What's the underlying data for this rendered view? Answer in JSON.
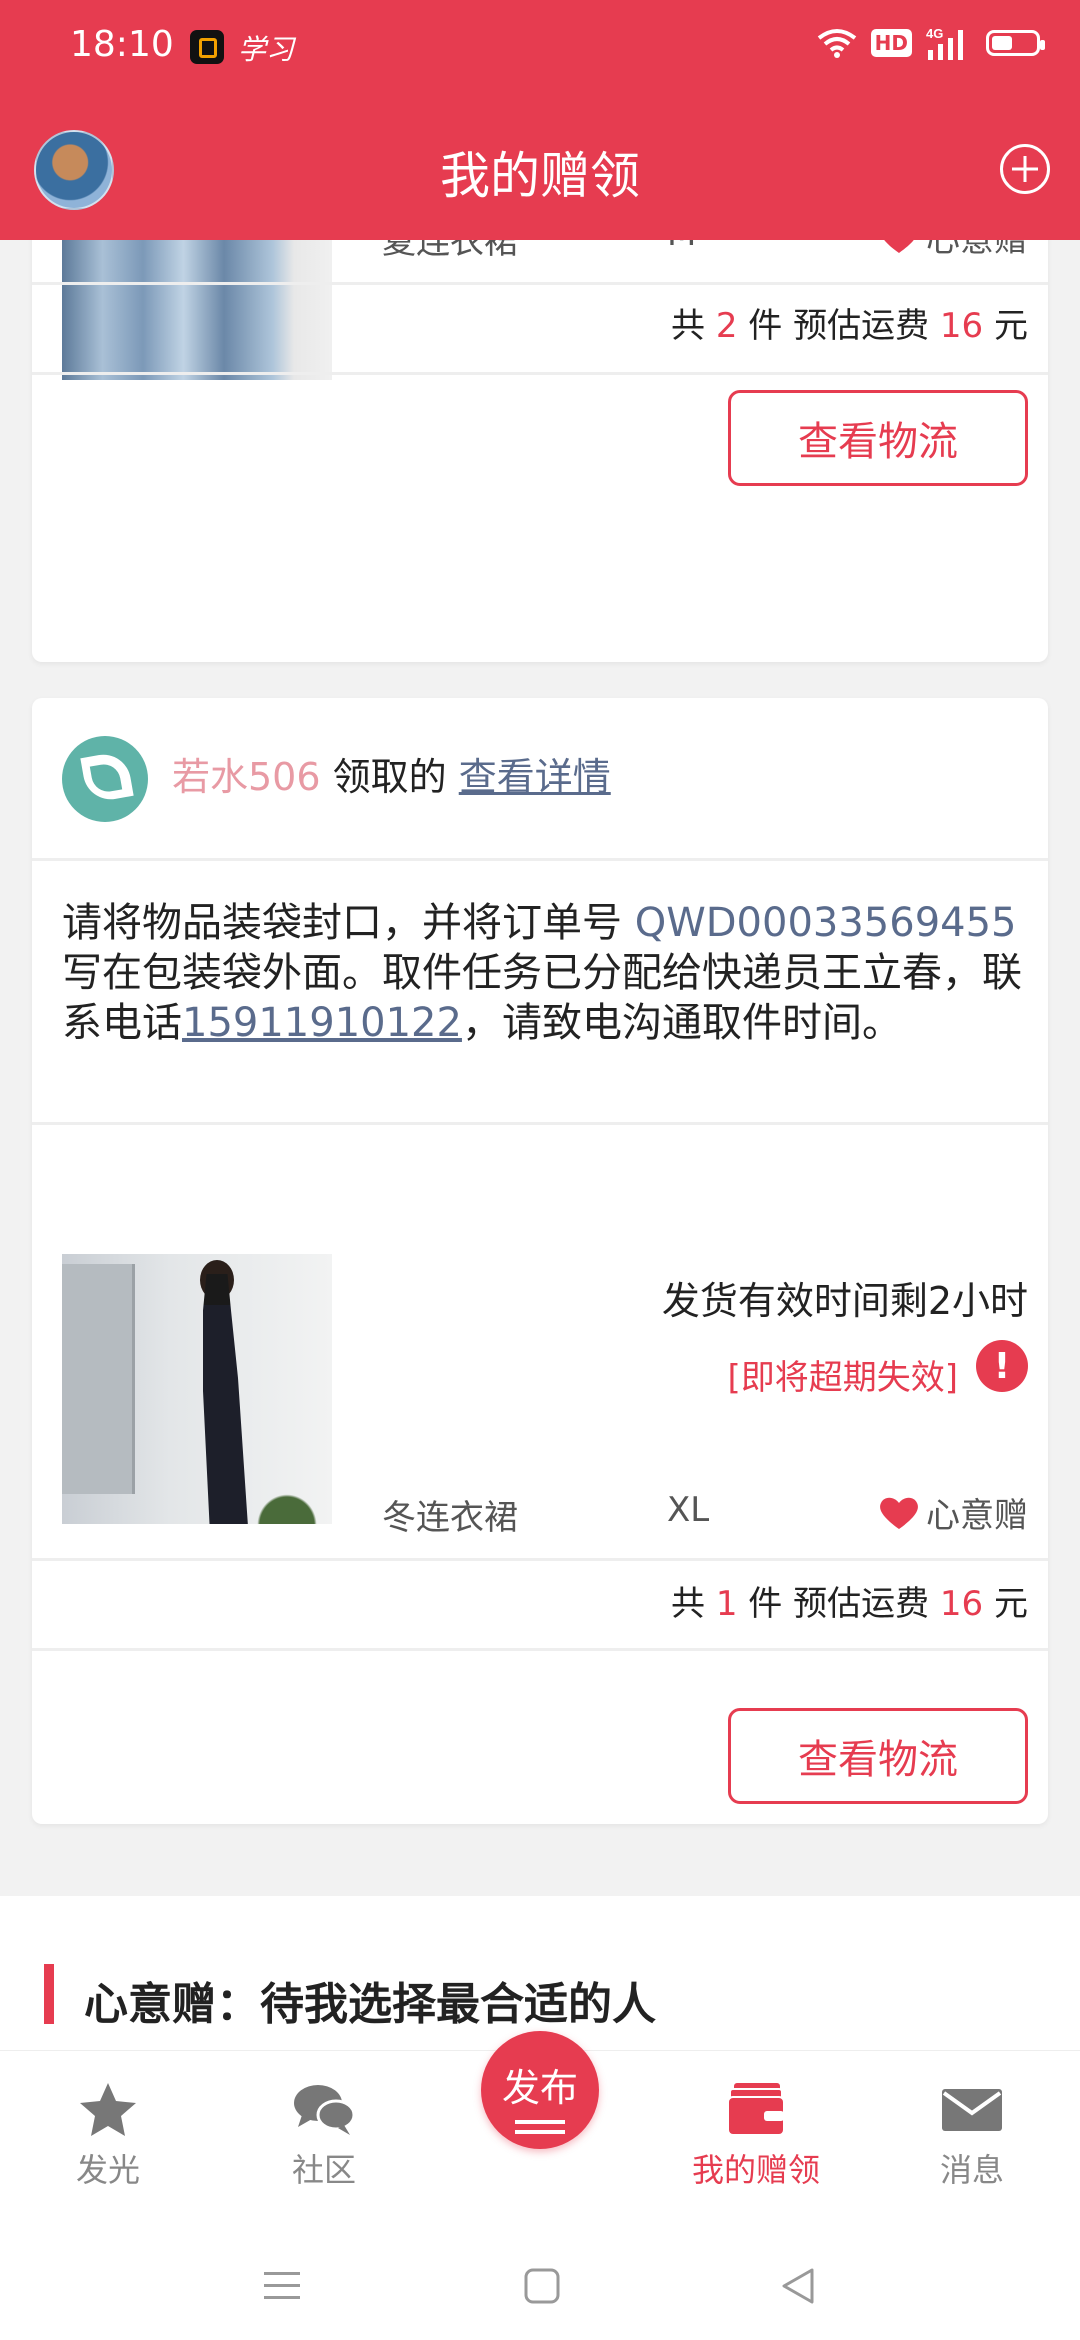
{
  "status_bar": {
    "time": "18:10",
    "app_label": "学习",
    "network": "4G"
  },
  "header": {
    "title": "我的赠领"
  },
  "order1": {
    "item": {
      "name": "夏连衣裙",
      "size": "M",
      "gift_type": "心意赠"
    },
    "summary": {
      "prefix": "共",
      "count": "2",
      "middle": "件 预估运费",
      "fee": "16",
      "suffix": "元"
    },
    "logistics_button": "查看物流"
  },
  "order2": {
    "giver": {
      "name": "若水506",
      "action": "领取的",
      "details_link": "查看详情"
    },
    "instructions": {
      "part1": "请将物品装袋封口，并将订单号",
      "order_no": "QWD00033569455",
      "part2": "写在包装袋外面。取件任务已分配给快递员王立春，联系电话",
      "phone": "15911910122",
      "part3": "，请致电沟通取件时间。"
    },
    "deadline": "发货有效时间剩2小时",
    "expired_tag": "[即将超期失效]",
    "item": {
      "name": "冬连衣裙",
      "size": "XL",
      "gift_type": "心意赠"
    },
    "summary": {
      "prefix": "共",
      "count": "1",
      "middle": "件 预估运费",
      "fee": "16",
      "suffix": "元"
    },
    "logistics_button": "查看物流"
  },
  "section": {
    "title": "心意赠：待我选择最合适的人"
  },
  "tabbar": {
    "tabs": [
      {
        "label": "发光",
        "icon": "star-icon"
      },
      {
        "label": "社区",
        "icon": "chat-bubbles-icon"
      },
      {
        "label": "发布",
        "icon": "publish-icon"
      },
      {
        "label": "我的赠领",
        "icon": "wallet-icon"
      },
      {
        "label": "消息",
        "icon": "mail-icon"
      }
    ],
    "active_index": 3
  },
  "colors": {
    "brand": "#e63c50",
    "link": "#5a6b8c",
    "giver_name": "#e89aa4"
  }
}
